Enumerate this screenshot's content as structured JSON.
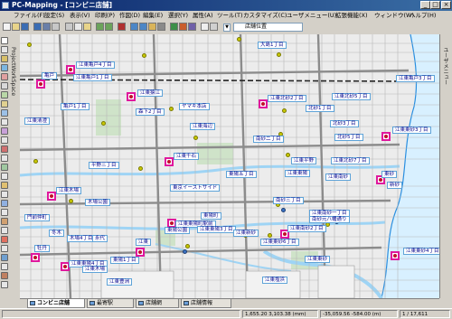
{
  "window": {
    "title": "PC-Mapping - [コンビニ店舗]",
    "buttons": [
      "_",
      "□",
      "×"
    ]
  },
  "menu": [
    "ファイル(F)",
    "設定(S)",
    "表示(V)",
    "印刷(P)",
    "作図(D)",
    "編集(E)",
    "選択(Y)",
    "属性(A)",
    "ツール(T)",
    "カスタマイズ(C)",
    "ユーザメニュー(U)",
    "拡張機能(X)",
    "ウィンドウ(W)",
    "ヘルプ(H)"
  ],
  "toolbar": {
    "address_value": "店舗位置"
  },
  "left_panel_label": "ProjectWorkSpace",
  "right_panel_label": "ユーザメニュー",
  "map": {
    "labels": [
      "大島1丁目",
      "亀戸",
      "江東亀戸4丁目",
      "江東亀戸1丁目",
      "江東亀戸3丁目",
      "江東北砂5丁目",
      "北砂1丁目",
      "亀戸1丁目",
      "江東猿江",
      "森下2丁目",
      "ヤマキ本店",
      "江東北砂2丁目",
      "北砂3丁目",
      "江東清澄",
      "江東海辺",
      "南砂二丁目",
      "北砂5丁目",
      "江東東砂3丁目",
      "江東平野",
      "江東北砂7丁目",
      "平野三丁目",
      "江東千石",
      "東陽五丁目",
      "江東東陽",
      "江東南砂",
      "東砂",
      "新砂",
      "江東木場",
      "木場公園",
      "東京イーストサイド",
      "門前仲町",
      "冬木",
      "東陽町",
      "南砂三丁目",
      "江東東陽町駅前",
      "東陽公園",
      "江東東陽3丁目",
      "江東南砂2丁目",
      "江東新砂",
      "江東南砂一丁目",
      "南砂元八幡通り",
      "木場4丁目",
      "永代",
      "江東",
      "牡丹",
      "江東東陽4丁目",
      "東陽1丁目",
      "江東木場",
      "江東東砂4丁目",
      "江東東砂",
      "江東東砂6丁目",
      "江東塩浜",
      "江東豊洲"
    ]
  },
  "tabs": [
    "コンビニ店舗",
    "最寄駅",
    "店舗網",
    "店舗情報"
  ],
  "status": {
    "scale": "1,655.20  3,103.38 (mm)",
    "coords": "-35,059.56  -584.00 (m)",
    "page": "1 / 17,611"
  }
}
